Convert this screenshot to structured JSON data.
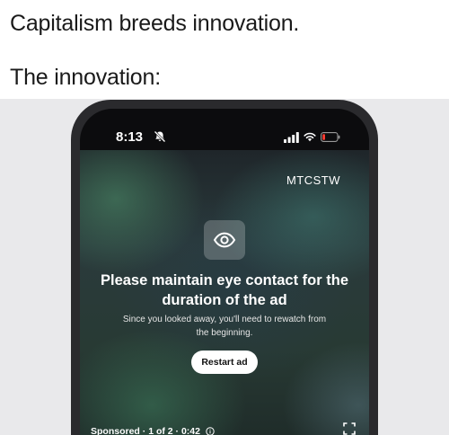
{
  "meme": {
    "line1": "Capitalism breeds innovation.",
    "line2": "The innovation:"
  },
  "status_bar": {
    "time": "8:13",
    "icons": [
      "bell-slash-icon",
      "cellular-signal-icon",
      "wifi-icon",
      "battery-low-icon"
    ],
    "battery_color": "#ff3b30"
  },
  "ad": {
    "channel": "MTCSTW",
    "icon": "eye-icon",
    "title": "Please maintain eye contact for the duration of the ad",
    "message": "Since you looked away, you'll need to rewatch from the beginning.",
    "restart_label": "Restart ad",
    "footer": {
      "sponsored": "Sponsored",
      "position": "1 of 2",
      "remaining": "0:42",
      "separator": "·",
      "info_icon": "info-icon"
    },
    "fullscreen_icon": "fullscreen-icon"
  }
}
